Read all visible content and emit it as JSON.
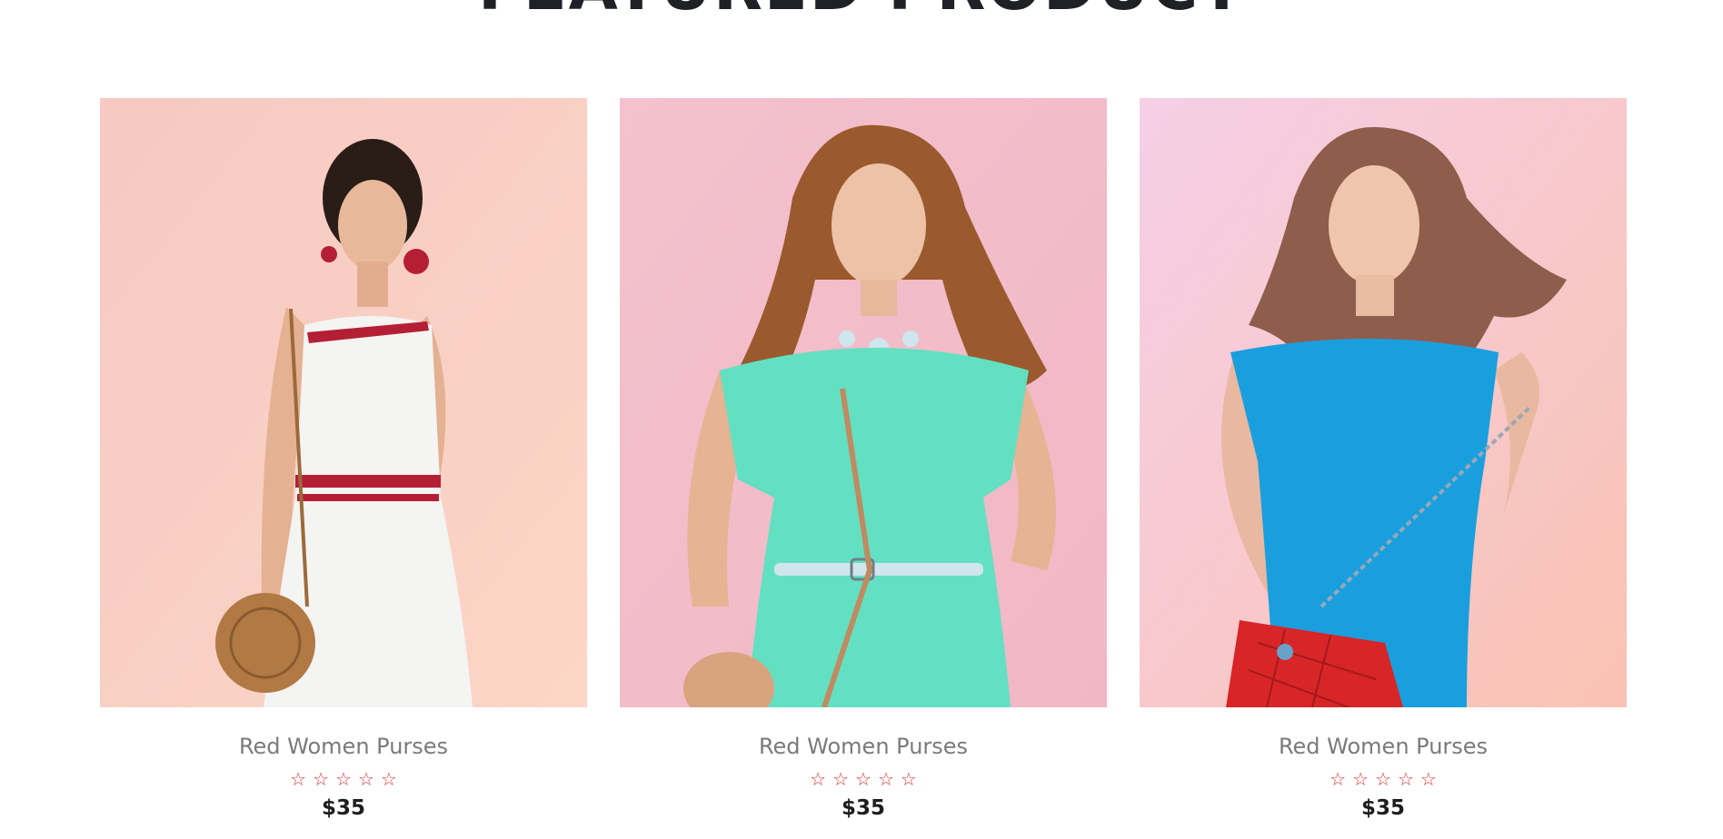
{
  "section": {
    "title": "FEATURED PRODUCT"
  },
  "products": [
    {
      "name": "Red Women Purses",
      "price": "$35",
      "rating": 0,
      "rating_max": 5,
      "star_glyph": "☆",
      "image": {
        "icon": "product-photo-icon",
        "subject": "woman in white knit dress with round straw bag",
        "bg_top": "#f6c9c3",
        "bg_bottom": "#fcd6c6",
        "outfit_color": "#f4f4f2",
        "accent_color": "#b51f35",
        "hair_color": "#2a1d18",
        "bag_color": "#b17a44"
      }
    },
    {
      "name": "Red Women Purses",
      "price": "$35",
      "rating": 0,
      "rating_max": 5,
      "star_glyph": "☆",
      "image": {
        "icon": "product-photo-icon",
        "subject": "woman in mint dress with tan shoulder bag",
        "bg_top": "#f4c1cd",
        "bg_bottom": "#f1b7c5",
        "outfit_color": "#63e0c1",
        "accent_color": "#cfe6ee",
        "hair_color": "#9a5a2e",
        "bag_color": "#d8a37f"
      }
    },
    {
      "name": "Red Women Purses",
      "price": "$35",
      "rating": 0,
      "rating_max": 5,
      "star_glyph": "☆",
      "image": {
        "icon": "product-photo-icon",
        "subject": "woman in blue dress with red quilted purse",
        "bg_top": "#f6cfe7",
        "bg_bottom": "#f9c2b2",
        "outfit_color": "#1a9fde",
        "accent_color": "#9aa7b6",
        "hair_color": "#8f5d4c",
        "bag_color": "#d82528"
      }
    }
  ],
  "colors": {
    "title": "#1f2127",
    "product_name": "#7a7a7a",
    "star": "#e0343b",
    "price": "#1d1d1d"
  }
}
